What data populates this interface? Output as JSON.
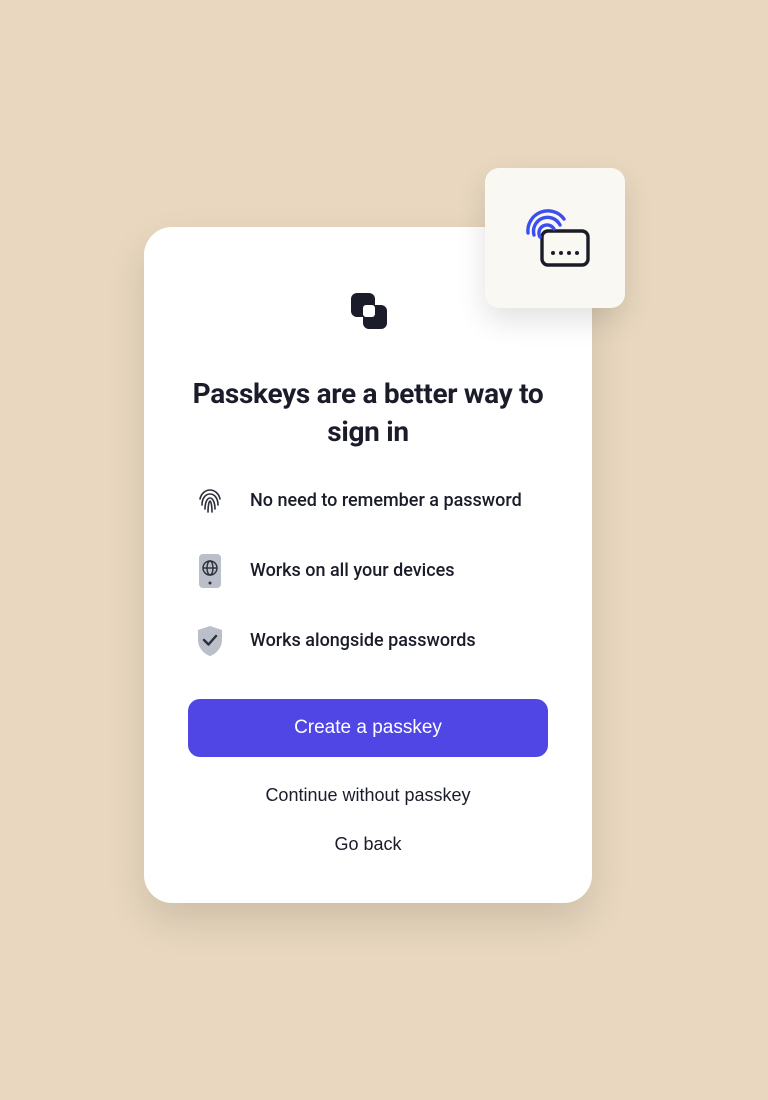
{
  "colors": {
    "background": "#e9d8bf",
    "card": "#ffffff",
    "text": "#1a1d29",
    "primary": "#4f46e5",
    "accent": "#3b4ef0",
    "badge_bg": "#faf8f3"
  },
  "title": "Passkeys are a better way to sign in",
  "features": [
    {
      "icon": "fingerprint-icon",
      "text": "No need to remember a password"
    },
    {
      "icon": "device-globe-icon",
      "text": "Works on all your devices"
    },
    {
      "icon": "shield-check-icon",
      "text": "Works alongside passwords"
    }
  ],
  "buttons": {
    "primary": "Create a passkey",
    "secondary": "Continue without passkey",
    "tertiary": "Go back"
  }
}
